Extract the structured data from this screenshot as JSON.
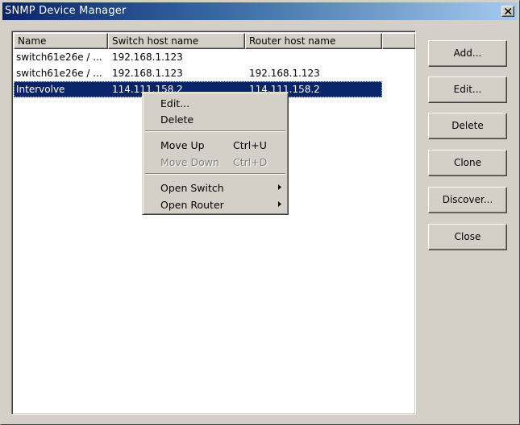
{
  "window": {
    "title": "SNMP Device Manager",
    "close_glyph": "×"
  },
  "table": {
    "columns": [
      "Name",
      "Switch host name",
      "Router host name",
      ""
    ],
    "rows": [
      {
        "name": "switch61e26e / ...",
        "switch_host": "192.168.1.123",
        "router_host": ""
      },
      {
        "name": "switch61e26e / ...",
        "switch_host": "192.168.1.123",
        "router_host": "192.168.1.123"
      },
      {
        "name": "Intervolve",
        "switch_host": "114.111.158.2",
        "router_host": "114.111.158.2",
        "selected": true
      }
    ]
  },
  "buttons": {
    "add": "Add...",
    "edit": "Edit...",
    "delete": "Delete",
    "clone": "Clone",
    "discover": "Discover...",
    "close": "Close"
  },
  "context_menu": {
    "edit": "Edit...",
    "delete": "Delete",
    "move_up": {
      "label": "Move Up",
      "shortcut": "Ctrl+U"
    },
    "move_down": {
      "label": "Move Down",
      "shortcut": "Ctrl+D",
      "disabled": true
    },
    "open_switch": "Open Switch",
    "open_router": "Open Router"
  },
  "colors": {
    "titlebar_start": "#0a246a",
    "titlebar_end": "#a6caf0",
    "selection": "#0a246a",
    "face": "#d4d0c8"
  }
}
